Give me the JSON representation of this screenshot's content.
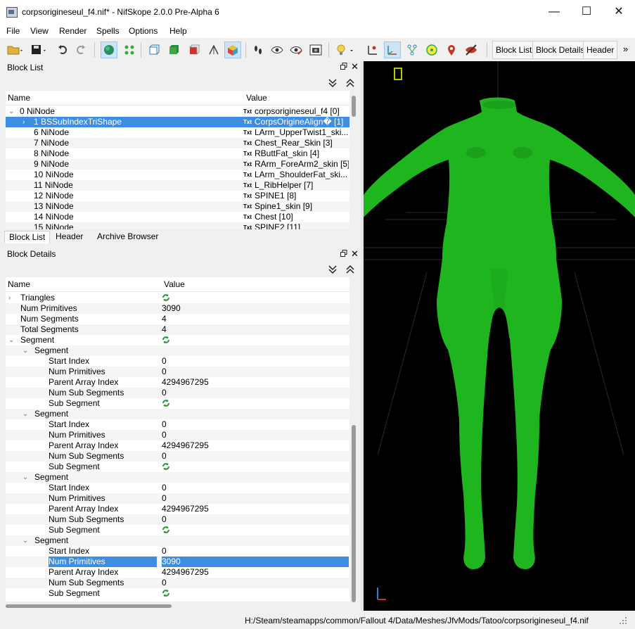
{
  "window": {
    "title": "corpsorigineseul_f4.nif* - NifSkope 2.0.0 Pre-Alpha 6",
    "minimize_glyph": "—",
    "maximize_glyph": "☐",
    "close_glyph": "✕"
  },
  "menu": [
    "File",
    "View",
    "Render",
    "Spells",
    "Options",
    "Help"
  ],
  "toolbar": {
    "block_list_label": "Block List",
    "block_details_label": "Block Details",
    "header_label": "Header",
    "overflow_glyph": "»"
  },
  "block_list": {
    "title": "Block List",
    "col_name": "Name",
    "col_value": "Value",
    "rows": [
      {
        "name": "0 NiNode",
        "value": "corpsorigineseul_f4 [0]",
        "expanded": true,
        "indent": 0
      },
      {
        "name": "1 BSSubIndexTriShape",
        "value": "CorpsOrigineAlign� [1]",
        "selected": true,
        "indent": 1
      },
      {
        "name": "6 NiNode",
        "value": "LArm_UpperTwist1_ski...",
        "indent": 1
      },
      {
        "name": "7 NiNode",
        "value": "Chest_Rear_Skin [3]",
        "indent": 1
      },
      {
        "name": "8 NiNode",
        "value": "RButtFat_skin [4]",
        "indent": 1
      },
      {
        "name": "9 NiNode",
        "value": "RArm_ForeArm2_skin [5]",
        "indent": 1
      },
      {
        "name": "10 NiNode",
        "value": "LArm_ShoulderFat_ski...",
        "indent": 1
      },
      {
        "name": "11 NiNode",
        "value": "L_RibHelper [7]",
        "indent": 1
      },
      {
        "name": "12 NiNode",
        "value": "SPINE1 [8]",
        "indent": 1
      },
      {
        "name": "13 NiNode",
        "value": "Spine1_skin [9]",
        "indent": 1
      },
      {
        "name": "14 NiNode",
        "value": "Chest [10]",
        "indent": 1
      },
      {
        "name": "15 NiNode",
        "value": "SPINE2 [11]",
        "indent": 1
      }
    ],
    "txt_badge": "Txt"
  },
  "tabs": [
    "Block List",
    "Header",
    "Archive Browser"
  ],
  "block_details": {
    "title": "Block Details",
    "col_name": "Name",
    "col_value": "Value",
    "rows": [
      {
        "name": "Triangles",
        "value": "",
        "cycle": true,
        "level": 0,
        "arrow": "collapsed"
      },
      {
        "name": "Num Primitives",
        "value": "3090",
        "level": 0
      },
      {
        "name": "Num Segments",
        "value": "4",
        "level": 0
      },
      {
        "name": "Total Segments",
        "value": "4",
        "level": 0
      },
      {
        "name": "Segment",
        "value": "",
        "cycle": true,
        "level": 0,
        "arrow": "expanded"
      },
      {
        "name": "Segment",
        "value": "",
        "level": 1,
        "arrow": "expanded"
      },
      {
        "name": "Start Index",
        "value": "0",
        "level": 2
      },
      {
        "name": "Num Primitives",
        "value": "0",
        "level": 2
      },
      {
        "name": "Parent Array Index",
        "value": "4294967295",
        "level": 2
      },
      {
        "name": "Num Sub Segments",
        "value": "0",
        "level": 2
      },
      {
        "name": "Sub Segment",
        "value": "",
        "cycle": true,
        "level": 2
      },
      {
        "name": "Segment",
        "value": "",
        "level": 1,
        "arrow": "expanded"
      },
      {
        "name": "Start Index",
        "value": "0",
        "level": 2
      },
      {
        "name": "Num Primitives",
        "value": "0",
        "level": 2
      },
      {
        "name": "Parent Array Index",
        "value": "4294967295",
        "level": 2
      },
      {
        "name": "Num Sub Segments",
        "value": "0",
        "level": 2
      },
      {
        "name": "Sub Segment",
        "value": "",
        "cycle": true,
        "level": 2
      },
      {
        "name": "Segment",
        "value": "",
        "level": 1,
        "arrow": "expanded"
      },
      {
        "name": "Start Index",
        "value": "0",
        "level": 2
      },
      {
        "name": "Num Primitives",
        "value": "0",
        "level": 2
      },
      {
        "name": "Parent Array Index",
        "value": "4294967295",
        "level": 2
      },
      {
        "name": "Num Sub Segments",
        "value": "0",
        "level": 2
      },
      {
        "name": "Sub Segment",
        "value": "",
        "cycle": true,
        "level": 2
      },
      {
        "name": "Segment",
        "value": "",
        "level": 1,
        "arrow": "expanded"
      },
      {
        "name": "Start Index",
        "value": "0",
        "level": 2
      },
      {
        "name": "Num Primitives",
        "value": "3090",
        "level": 2,
        "selected": true
      },
      {
        "name": "Parent Array Index",
        "value": "4294967295",
        "level": 2
      },
      {
        "name": "Num Sub Segments",
        "value": "0",
        "level": 2
      },
      {
        "name": "Sub Segment",
        "value": "",
        "cycle": true,
        "level": 2
      }
    ]
  },
  "status": {
    "path": "H:/Steam/steamapps/common/Fallout 4/Data/Meshes/JfvMods/Tatoo/corpsorigineseul_f4.nif"
  },
  "colors": {
    "mesh": "#1fb51f",
    "selection": "#3d8ee0",
    "viewport_bg": "#000000"
  }
}
